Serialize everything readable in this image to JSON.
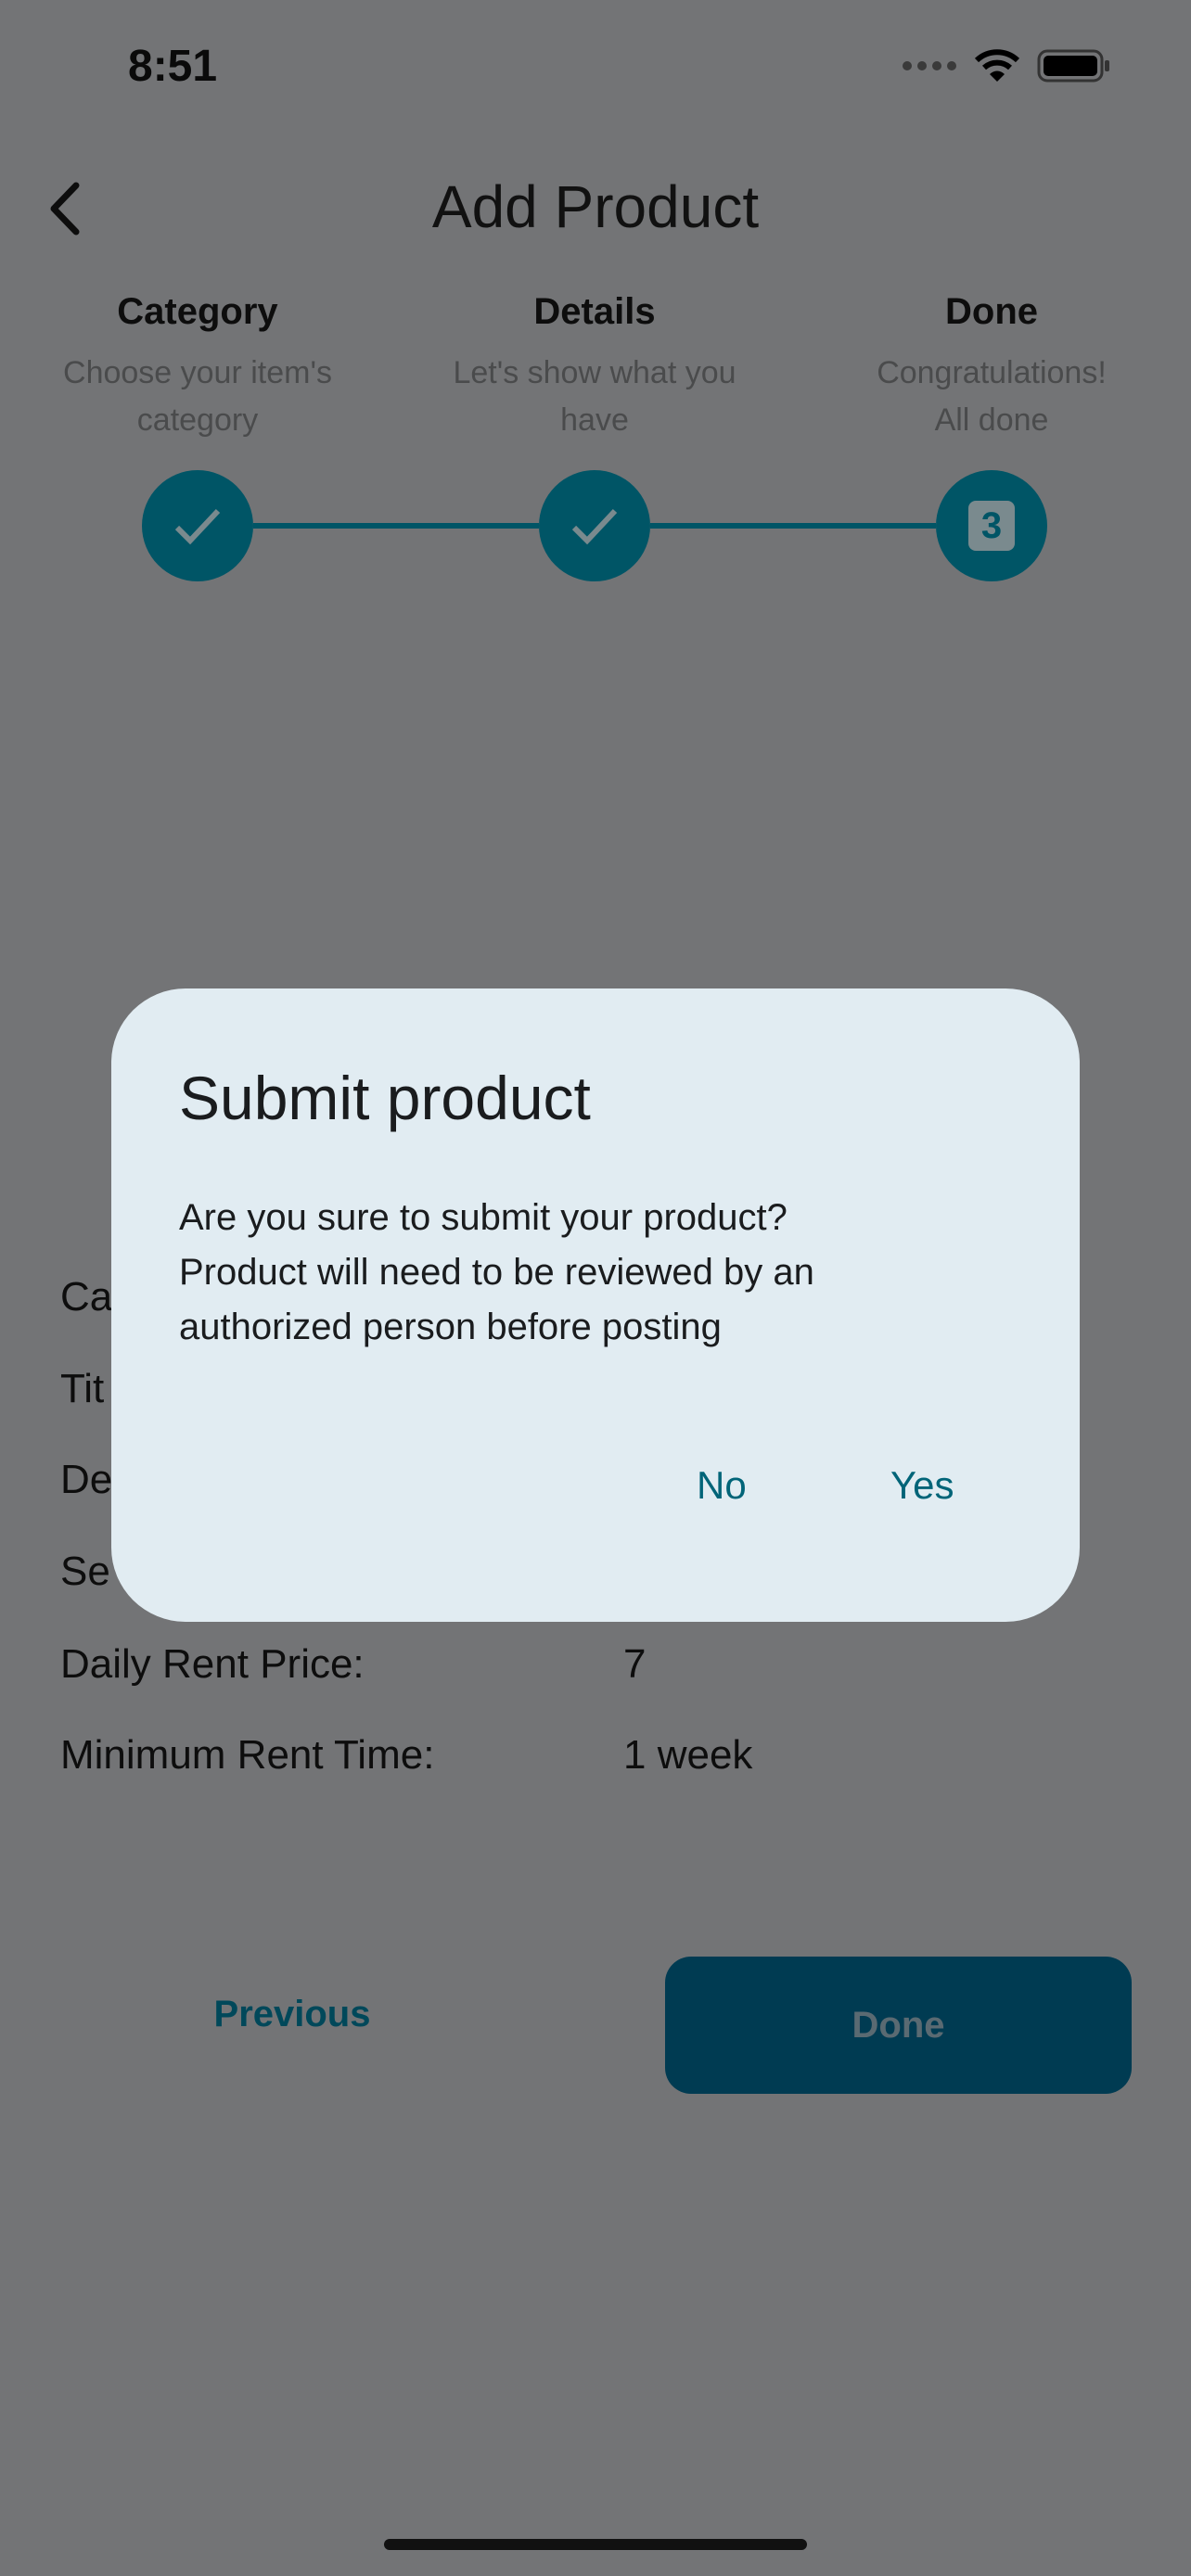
{
  "status_bar": {
    "time": "8:51",
    "icons": [
      "signal-dots-icon",
      "wifi-icon",
      "battery-icon"
    ]
  },
  "header": {
    "title": "Add Product",
    "back_icon": "chevron-left-icon"
  },
  "stepper": {
    "steps": [
      {
        "title": "Category",
        "subtitle_line1": "Choose your item's",
        "subtitle_line2": "category",
        "state": "completed"
      },
      {
        "title": "Details",
        "subtitle_line1": "Let's show what you",
        "subtitle_line2": "have",
        "state": "completed"
      },
      {
        "title": "Done",
        "subtitle_line1": "Congratulations!",
        "subtitle_line2": "All done",
        "state": "current",
        "number": "3"
      }
    ],
    "accent_color": "#005566"
  },
  "summary": {
    "rows": [
      {
        "label": "Ca",
        "value": ""
      },
      {
        "label": "Tit",
        "value": ""
      },
      {
        "label": "De",
        "value": ""
      },
      {
        "label": "Se",
        "value": ""
      },
      {
        "label": "Daily Rent Price:",
        "value": "7"
      },
      {
        "label": "Minimum Rent Time:",
        "value": "1 week"
      }
    ]
  },
  "footer": {
    "previous_label": "Previous",
    "done_label": "Done"
  },
  "dialog": {
    "title": "Submit product",
    "body_line1": "Are you sure to submit your product?",
    "body_line2": "Product will need to be reviewed by an",
    "body_line3": "authorized person before posting",
    "no_label": "No",
    "yes_label": "Yes"
  }
}
